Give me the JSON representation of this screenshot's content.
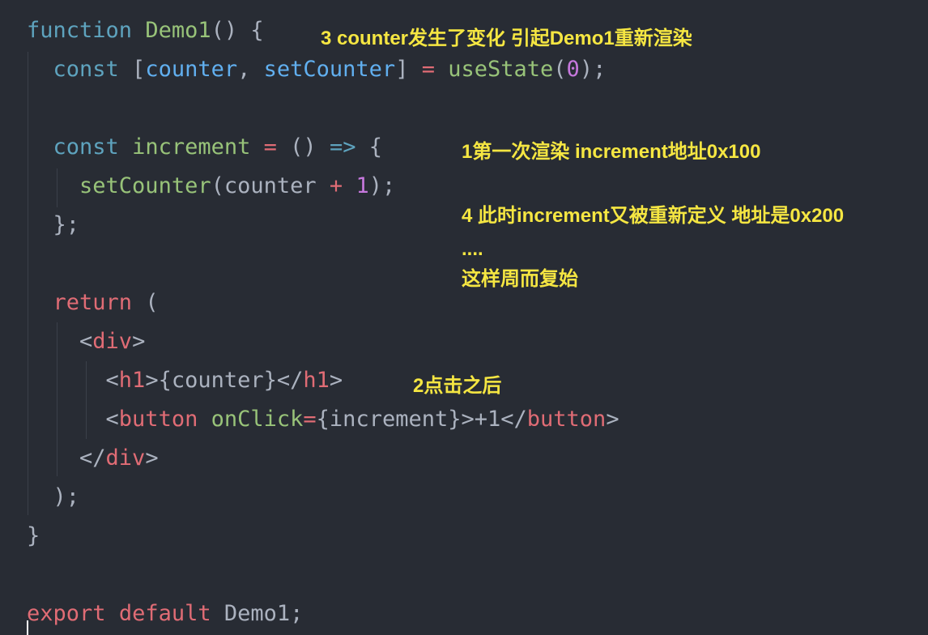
{
  "colors": {
    "background": "#282c34",
    "plain": "#abb2bf",
    "keyword": "#5ea3be",
    "keyword_pink": "#e06c75",
    "function": "#98c379",
    "variable": "#61afef",
    "operator": "#e06c75",
    "number": "#c678dd",
    "tag": "#e06c75",
    "annotation": "#f5e642",
    "guide": "#3b404a"
  },
  "code_lines": [
    {
      "tokens": [
        {
          "text": "function",
          "type": "keyword"
        },
        {
          "text": " ",
          "type": "plain"
        },
        {
          "text": "Demo1",
          "type": "function"
        },
        {
          "text": "() {",
          "type": "plain"
        }
      ]
    },
    {
      "tokens": [
        {
          "text": "  ",
          "type": "plain"
        },
        {
          "text": "const",
          "type": "keyword"
        },
        {
          "text": " [",
          "type": "plain"
        },
        {
          "text": "counter",
          "type": "variable"
        },
        {
          "text": ", ",
          "type": "plain"
        },
        {
          "text": "setCounter",
          "type": "variable"
        },
        {
          "text": "] ",
          "type": "plain"
        },
        {
          "text": "=",
          "type": "operator"
        },
        {
          "text": " ",
          "type": "plain"
        },
        {
          "text": "useState",
          "type": "function"
        },
        {
          "text": "(",
          "type": "plain"
        },
        {
          "text": "0",
          "type": "number"
        },
        {
          "text": ");",
          "type": "plain"
        }
      ]
    },
    {
      "tokens": []
    },
    {
      "tokens": [
        {
          "text": "  ",
          "type": "plain"
        },
        {
          "text": "const",
          "type": "keyword"
        },
        {
          "text": " ",
          "type": "plain"
        },
        {
          "text": "increment",
          "type": "function"
        },
        {
          "text": " ",
          "type": "plain"
        },
        {
          "text": "=",
          "type": "operator"
        },
        {
          "text": " () ",
          "type": "plain"
        },
        {
          "text": "=>",
          "type": "keyword"
        },
        {
          "text": " {",
          "type": "plain"
        }
      ]
    },
    {
      "tokens": [
        {
          "text": "    ",
          "type": "plain"
        },
        {
          "text": "setCounter",
          "type": "function"
        },
        {
          "text": "(counter ",
          "type": "plain"
        },
        {
          "text": "+",
          "type": "operator"
        },
        {
          "text": " ",
          "type": "plain"
        },
        {
          "text": "1",
          "type": "number"
        },
        {
          "text": ");",
          "type": "plain"
        }
      ]
    },
    {
      "tokens": [
        {
          "text": "  };",
          "type": "plain"
        }
      ]
    },
    {
      "tokens": []
    },
    {
      "tokens": [
        {
          "text": "  ",
          "type": "plain"
        },
        {
          "text": "return",
          "type": "keyword_pink"
        },
        {
          "text": " (",
          "type": "plain"
        }
      ]
    },
    {
      "tokens": [
        {
          "text": "    <",
          "type": "plain"
        },
        {
          "text": "div",
          "type": "tag"
        },
        {
          "text": ">",
          "type": "plain"
        }
      ]
    },
    {
      "tokens": [
        {
          "text": "      <",
          "type": "plain"
        },
        {
          "text": "h1",
          "type": "tag"
        },
        {
          "text": ">{counter}</",
          "type": "plain"
        },
        {
          "text": "h1",
          "type": "tag"
        },
        {
          "text": ">",
          "type": "plain"
        }
      ]
    },
    {
      "tokens": [
        {
          "text": "      <",
          "type": "plain"
        },
        {
          "text": "button",
          "type": "tag"
        },
        {
          "text": " ",
          "type": "plain"
        },
        {
          "text": "onClick",
          "type": "function"
        },
        {
          "text": "=",
          "type": "operator"
        },
        {
          "text": "{increment}>+1</",
          "type": "plain"
        },
        {
          "text": "button",
          "type": "tag"
        },
        {
          "text": ">",
          "type": "plain"
        }
      ]
    },
    {
      "tokens": [
        {
          "text": "    </",
          "type": "plain"
        },
        {
          "text": "div",
          "type": "tag"
        },
        {
          "text": ">",
          "type": "plain"
        }
      ]
    },
    {
      "tokens": [
        {
          "text": "  );",
          "type": "plain"
        }
      ]
    },
    {
      "tokens": [
        {
          "text": "}",
          "type": "plain"
        }
      ]
    },
    {
      "tokens": []
    },
    {
      "tokens": [
        {
          "text": "export",
          "type": "keyword_pink"
        },
        {
          "text": " ",
          "type": "plain"
        },
        {
          "text": "default",
          "type": "keyword_pink"
        },
        {
          "text": " Demo1;",
          "type": "plain"
        }
      ]
    }
  ],
  "annotations": {
    "note_3": "3 counter发生了变化 引起Demo1重新渲染",
    "note_1": "1第一次渲染 increment地址0x100",
    "note_4": "4 此时increment又被重新定义 地址是0x200",
    "note_dots": "....",
    "note_cycle": "这样周而复始",
    "note_2": "2点击之后"
  }
}
